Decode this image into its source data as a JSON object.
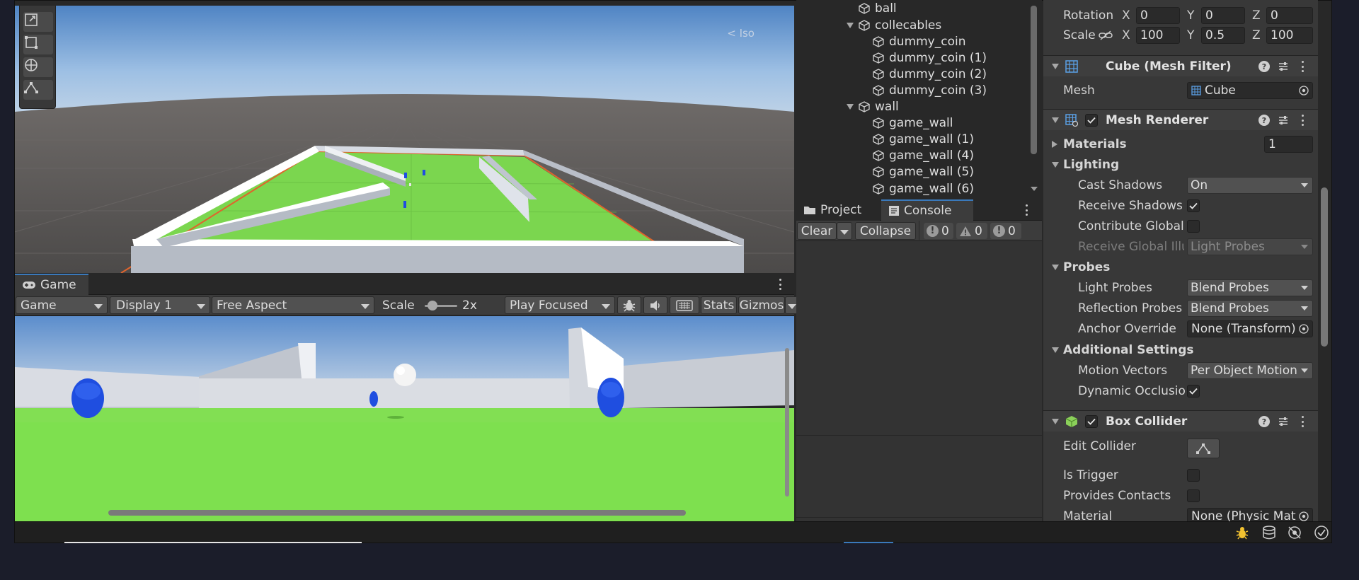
{
  "scene": {
    "overlay_label": "< Iso"
  },
  "game_panel": {
    "tab_label": "Game",
    "toolbar": {
      "mode": "Game",
      "display": "Display 1",
      "aspect": "Free Aspect",
      "scale_label": "Scale",
      "scale_value": "2x",
      "play_mode": "Play Focused",
      "stats": "Stats",
      "gizmos": "Gizmos"
    }
  },
  "hierarchy": {
    "items": [
      {
        "label": "ball",
        "level": 0,
        "expanded": null
      },
      {
        "label": "collecables",
        "level": 0,
        "expanded": true
      },
      {
        "label": "dummy_coin",
        "level": 1,
        "expanded": null
      },
      {
        "label": "dummy_coin (1)",
        "level": 1,
        "expanded": null
      },
      {
        "label": "dummy_coin (2)",
        "level": 1,
        "expanded": null
      },
      {
        "label": "dummy_coin (3)",
        "level": 1,
        "expanded": null
      },
      {
        "label": "wall",
        "level": 0,
        "expanded": true
      },
      {
        "label": "game_wall",
        "level": 1,
        "expanded": null
      },
      {
        "label": "game_wall (1)",
        "level": 1,
        "expanded": null
      },
      {
        "label": "game_wall (4)",
        "level": 1,
        "expanded": null
      },
      {
        "label": "game_wall (5)",
        "level": 1,
        "expanded": null
      },
      {
        "label": "game_wall (6)",
        "level": 1,
        "expanded": null
      }
    ]
  },
  "console_panel": {
    "tabs": [
      "Project",
      "Console"
    ],
    "clear": "Clear",
    "collapse": "Collapse",
    "log_count": "0",
    "warning_count": "0",
    "error_count": "0"
  },
  "inspector": {
    "transform": {
      "rotation_label": "Rotation",
      "rotation": {
        "x": "0",
        "y": "0",
        "z": "0"
      },
      "scale_label": "Scale",
      "scale": {
        "x": "100",
        "y": "0.5",
        "z": "100"
      }
    },
    "mesh_filter": {
      "title": "Cube (Mesh Filter)",
      "mesh_label": "Mesh",
      "mesh_value": "Cube"
    },
    "mesh_renderer": {
      "title": "Mesh Renderer",
      "enabled": true,
      "materials_label": "Materials",
      "materials_count": "1",
      "lighting_label": "Lighting",
      "cast_shadows_label": "Cast Shadows",
      "cast_shadows_value": "On",
      "receive_shadows_label": "Receive Shadows",
      "receive_shadows_checked": true,
      "contribute_gi_label": "Contribute Global",
      "contribute_gi_checked": false,
      "receive_gi_label": "Receive Global Illu",
      "receive_gi_value": "Light Probes",
      "probes_label": "Probes",
      "light_probes_label": "Light Probes",
      "light_probes_value": "Blend Probes",
      "reflection_probes_label": "Reflection Probes",
      "reflection_probes_value": "Blend Probes",
      "anchor_override_label": "Anchor Override",
      "anchor_override_value": "None (Transform)",
      "additional_label": "Additional Settings",
      "motion_vectors_label": "Motion Vectors",
      "motion_vectors_value": "Per Object Motion",
      "dynamic_occlusion_label": "Dynamic Occlusio",
      "dynamic_occlusion_checked": true
    },
    "box_collider": {
      "title": "Box Collider",
      "enabled": true,
      "edit_collider_label": "Edit Collider",
      "is_trigger_label": "Is Trigger",
      "is_trigger_checked": false,
      "provides_contacts_label": "Provides Contacts",
      "provides_contacts_checked": false,
      "material_label": "Material",
      "material_value": "None (Physic Mat"
    }
  },
  "colors": {
    "accent": "#3a79bb",
    "panel_bg": "#383838",
    "ground_green": "#7bd64f",
    "coin_blue": "#1f4ee0"
  }
}
